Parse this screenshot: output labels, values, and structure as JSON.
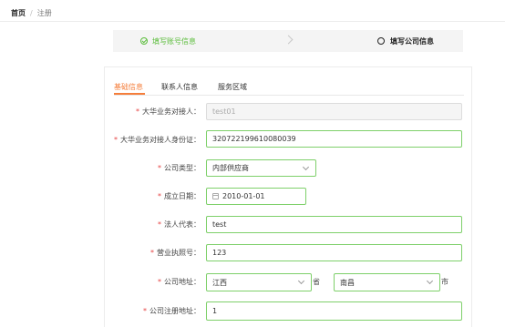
{
  "breadcrumb": {
    "home": "首页",
    "separator": "/",
    "current": "注册"
  },
  "steps": [
    {
      "label": "填写账号信息",
      "status": "done"
    },
    {
      "label": "填写公司信息",
      "status": "active"
    }
  ],
  "tabs": [
    {
      "label": "基础信息",
      "active": true
    },
    {
      "label": "联系人信息",
      "active": false
    },
    {
      "label": "服务区域",
      "active": false
    }
  ],
  "form": {
    "contact": {
      "label": "大华业务对接人：",
      "value": "test01"
    },
    "id_card": {
      "label": "大华业务对接人身份证：",
      "value": "320722199610080039"
    },
    "company_type": {
      "label": "公司类型：",
      "value": "内部供应商"
    },
    "established": {
      "label": "成立日期：",
      "value": "2010-01-01"
    },
    "legal_rep": {
      "label": "法人代表：",
      "value": "test"
    },
    "license": {
      "label": "营业执照号：",
      "value": "123"
    },
    "address": {
      "label": "公司地址：",
      "province": "江西",
      "province_suffix": "省",
      "city": "南昌",
      "city_suffix": "市"
    },
    "reg_address": {
      "label": "公司注册地址：",
      "value": "1"
    }
  },
  "colors": {
    "accent": "#f57e3b",
    "success": "#5bbd3b",
    "field_border": "#7ed06a",
    "required": "#e64545"
  }
}
